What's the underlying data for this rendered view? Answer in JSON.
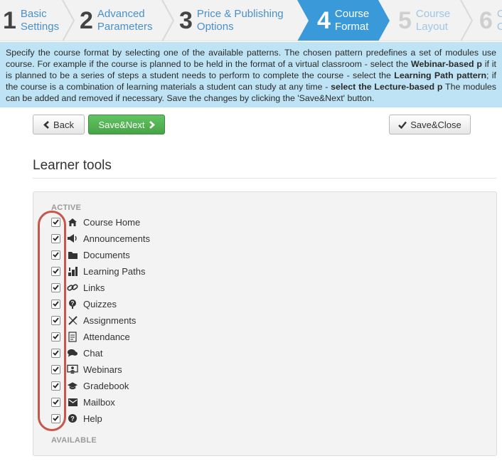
{
  "steps": [
    {
      "num": "1",
      "line1": "Basic",
      "line2": "Settings",
      "state": "done"
    },
    {
      "num": "2",
      "line1": "Advanced",
      "line2": "Parameters",
      "state": "done"
    },
    {
      "num": "3",
      "line1": "Price & Publishing",
      "line2": "Options",
      "state": "done"
    },
    {
      "num": "4",
      "line1": "Course",
      "line2": "Format",
      "state": "active"
    },
    {
      "num": "5",
      "line1": "Course",
      "line2": "Layout",
      "state": "inactive"
    },
    {
      "num": "6",
      "line1": "C",
      "line2": "C",
      "state": "inactive"
    }
  ],
  "info": {
    "t1": "Specify the course format by selecting one of the available patterns. The chosen pattern predefines a set of modules use course. For example if the course is planned to be held in the format of a virtual classroom - select the ",
    "b1": "Webinar-based p",
    "t2": " if it is planned to be a series of steps a student needs to perform to complete the course - select the ",
    "b2": "Learning Path pattern",
    "t3": "; if the course is a combination of learning materials a student can study at any time - ",
    "b3": "select the Lecture-based p",
    "t4": " The modules can be added and removed if necessary. Save the changes by clicking the 'Save&Next' button."
  },
  "toolbar": {
    "back_label": "Back",
    "save_next_label": "Save&Next",
    "save_close_label": "Save&Close"
  },
  "section": {
    "title": "Learner tools",
    "active_label": "ACTIVE",
    "available_label": "AVAILABLE"
  },
  "tools": [
    {
      "label": "Course Home",
      "icon": "home-icon",
      "checked": true
    },
    {
      "label": "Announcements",
      "icon": "megaphone-icon",
      "checked": true
    },
    {
      "label": "Documents",
      "icon": "folder-icon",
      "checked": true
    },
    {
      "label": "Learning Paths",
      "icon": "learning-path-icon",
      "checked": true
    },
    {
      "label": "Links",
      "icon": "link-icon",
      "checked": true
    },
    {
      "label": "Quizzes",
      "icon": "quiz-icon",
      "checked": true
    },
    {
      "label": "Assignments",
      "icon": "pencil-ruler-icon",
      "checked": true
    },
    {
      "label": "Attendance",
      "icon": "attendance-icon",
      "checked": true
    },
    {
      "label": "Chat",
      "icon": "chat-icon",
      "checked": true
    },
    {
      "label": "Webinars",
      "icon": "webinar-icon",
      "checked": true
    },
    {
      "label": "Gradebook",
      "icon": "graduation-cap-icon",
      "checked": true
    },
    {
      "label": "Mailbox",
      "icon": "mailbox-icon",
      "checked": true
    },
    {
      "label": "Help",
      "icon": "help-icon",
      "checked": true
    }
  ],
  "colors": {
    "active_step": "#3a9ad9",
    "info_bg": "#bde3f5",
    "save_next_green": "#4cae4c",
    "highlight_red": "#c0392b"
  }
}
